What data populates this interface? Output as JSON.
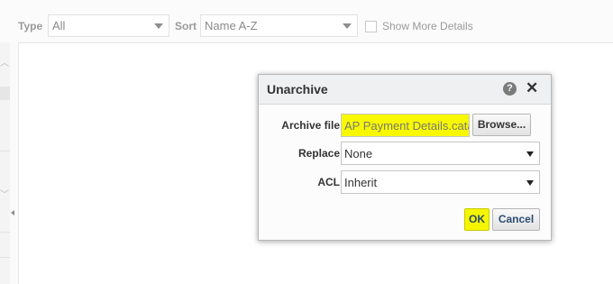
{
  "toolbar": {
    "type_label": "Type",
    "type_value": "All",
    "sort_label": "Sort",
    "sort_value": "Name A-Z",
    "show_more_label": "Show More Details"
  },
  "dialog": {
    "title": "Unarchive",
    "help_glyph": "?",
    "close_glyph": "✕",
    "archive_file_label": "Archive file",
    "archive_file_value": "AP Payment Details.cata",
    "browse_label": "Browse...",
    "replace_label": "Replace",
    "replace_value": "None",
    "acl_label": "ACL",
    "acl_value": "Inherit",
    "ok_label": "OK",
    "cancel_label": "Cancel"
  },
  "colors": {
    "highlight": "#f5f500",
    "link_blue": "#2a4d73"
  }
}
